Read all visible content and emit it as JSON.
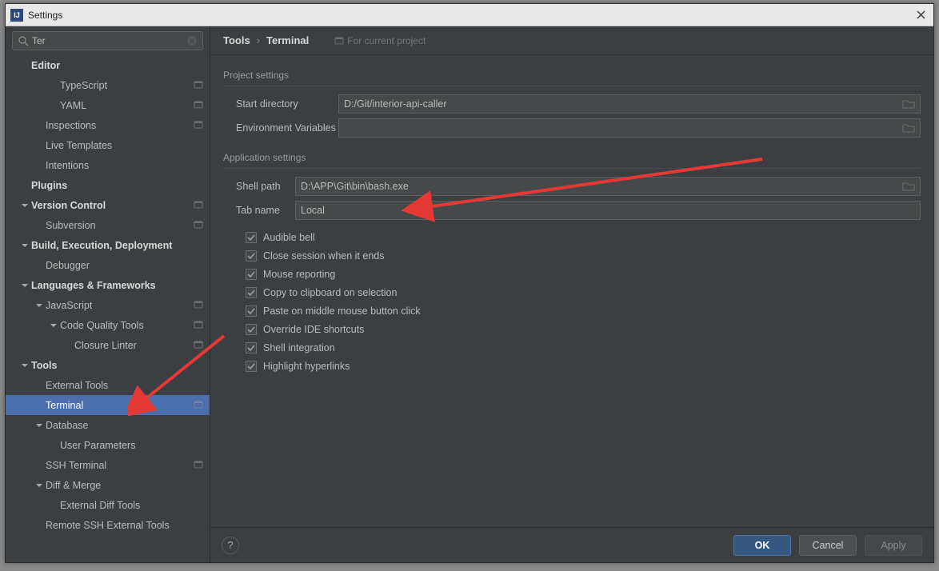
{
  "window": {
    "title": "Settings"
  },
  "search": {
    "value": "Ter"
  },
  "sidebar": [
    {
      "label": "Editor",
      "indent": 0,
      "bold": true,
      "chev": false,
      "proj": false
    },
    {
      "label": "TypeScript",
      "indent": 2,
      "bold": false,
      "chev": false,
      "proj": true
    },
    {
      "label": "YAML",
      "indent": 2,
      "bold": false,
      "chev": false,
      "proj": true
    },
    {
      "label": "Inspections",
      "indent": 1,
      "bold": false,
      "chev": false,
      "proj": true
    },
    {
      "label": "Live Templates",
      "indent": 1,
      "bold": false,
      "chev": false,
      "proj": false
    },
    {
      "label": "Intentions",
      "indent": 1,
      "bold": false,
      "chev": false,
      "proj": false
    },
    {
      "label": "Plugins",
      "indent": 0,
      "bold": true,
      "chev": false,
      "proj": false
    },
    {
      "label": "Version Control",
      "indent": 0,
      "bold": true,
      "chev": true,
      "proj": true
    },
    {
      "label": "Subversion",
      "indent": 1,
      "bold": false,
      "chev": false,
      "proj": true
    },
    {
      "label": "Build, Execution, Deployment",
      "indent": 0,
      "bold": true,
      "chev": true,
      "proj": false
    },
    {
      "label": "Debugger",
      "indent": 1,
      "bold": false,
      "chev": false,
      "proj": false
    },
    {
      "label": "Languages & Frameworks",
      "indent": 0,
      "bold": true,
      "chev": true,
      "proj": false
    },
    {
      "label": "JavaScript",
      "indent": 1,
      "bold": false,
      "chev": true,
      "proj": true
    },
    {
      "label": "Code Quality Tools",
      "indent": 2,
      "bold": false,
      "chev": true,
      "proj": true
    },
    {
      "label": "Closure Linter",
      "indent": 3,
      "bold": false,
      "chev": false,
      "proj": true
    },
    {
      "label": "Tools",
      "indent": 0,
      "bold": true,
      "chev": true,
      "proj": false
    },
    {
      "label": "External Tools",
      "indent": 1,
      "bold": false,
      "chev": false,
      "proj": false
    },
    {
      "label": "Terminal",
      "indent": 1,
      "bold": false,
      "chev": false,
      "proj": true,
      "selected": true
    },
    {
      "label": "Database",
      "indent": 1,
      "bold": false,
      "chev": true,
      "proj": false
    },
    {
      "label": "User Parameters",
      "indent": 2,
      "bold": false,
      "chev": false,
      "proj": false
    },
    {
      "label": "SSH Terminal",
      "indent": 1,
      "bold": false,
      "chev": false,
      "proj": true
    },
    {
      "label": "Diff & Merge",
      "indent": 1,
      "bold": false,
      "chev": true,
      "proj": false
    },
    {
      "label": "External Diff Tools",
      "indent": 2,
      "bold": false,
      "chev": false,
      "proj": false
    },
    {
      "label": "Remote SSH External Tools",
      "indent": 1,
      "bold": false,
      "chev": false,
      "proj": false
    }
  ],
  "breadcrumb": {
    "root": "Tools",
    "leaf": "Terminal",
    "for_project": "For current project"
  },
  "sections": {
    "project": {
      "title": "Project settings",
      "start_dir_label": "Start directory",
      "start_dir_value": "D:/Git/interior-api-caller",
      "env_label": "Environment Variables",
      "env_value": ""
    },
    "app": {
      "title": "Application settings",
      "shell_path_label": "Shell path",
      "shell_path_value": "D:\\APP\\Git\\bin\\bash.exe",
      "tab_name_label": "Tab name",
      "tab_name_value": "Local"
    }
  },
  "checks": [
    "Audible bell",
    "Close session when it ends",
    "Mouse reporting",
    "Copy to clipboard on selection",
    "Paste on middle mouse button click",
    "Override IDE shortcuts",
    "Shell integration",
    "Highlight hyperlinks"
  ],
  "footer": {
    "ok": "OK",
    "cancel": "Cancel",
    "apply": "Apply"
  }
}
